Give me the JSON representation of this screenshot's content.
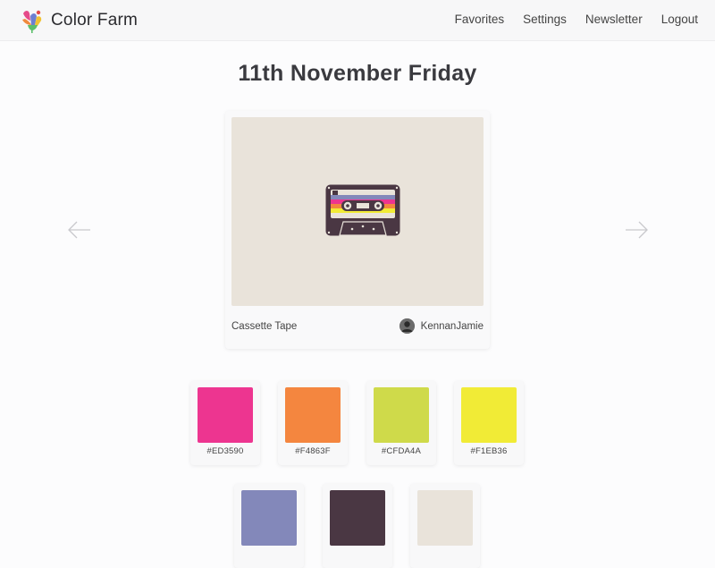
{
  "app": {
    "brand_name": "Color Farm"
  },
  "nav": {
    "links": [
      {
        "label": "Favorites"
      },
      {
        "label": "Settings"
      },
      {
        "label": "Newsletter"
      },
      {
        "label": "Logout"
      }
    ]
  },
  "main": {
    "date_title": "11th November Friday",
    "prev_icon": "arrow-left-icon",
    "next_icon": "arrow-right-icon"
  },
  "featured": {
    "caption": "Cassette Tape",
    "author": "KennanJamie",
    "image_background": "#E9E3DA",
    "illustration": "cassette-tape"
  },
  "palette": {
    "swatches": [
      {
        "hex": "#ED3590",
        "color": "#ED3590"
      },
      {
        "hex": "#F4863F",
        "color": "#F4863F"
      },
      {
        "hex": "#CFDA4A",
        "color": "#CFDA4A"
      },
      {
        "hex": "#F1EB36",
        "color": "#F1EB36"
      },
      {
        "hex": "",
        "color": "#8388BA"
      },
      {
        "hex": "",
        "color": "#4A3743"
      },
      {
        "hex": "",
        "color": "#E9E3DA"
      }
    ]
  }
}
